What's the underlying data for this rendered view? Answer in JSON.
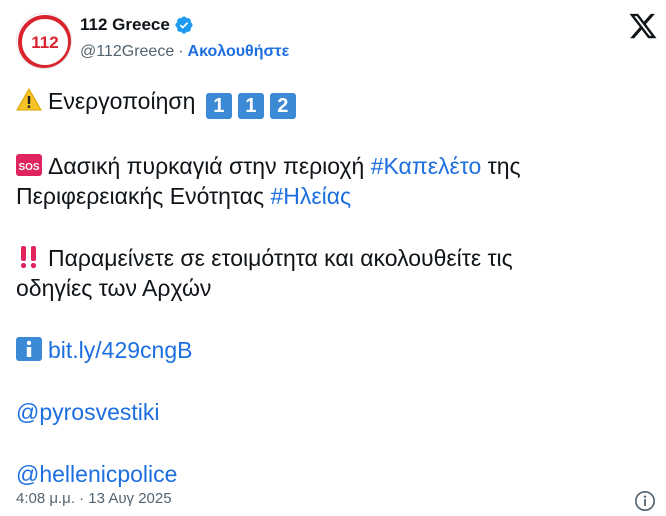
{
  "author": {
    "name": "112 Greece",
    "handle": "@112Greece",
    "separator": "·",
    "follow_label": "Ακολουθήστε",
    "avatar_text": "112"
  },
  "tweet": {
    "line1_text": "Ενεργοποίηση",
    "line1_digits": [
      "1",
      "1",
      "2"
    ],
    "line2_part1": "Δασική πυρκαγιά στην περιοχή",
    "hashtag1": "#Καπελέτο",
    "line2_part2": "της",
    "line3_part1": "Περιφερειακής Ενότητας",
    "hashtag2": "#Ηλείας",
    "line4": "Παραμείνετε σε ετοιμότητα και ακολουθείτε τις",
    "line5": "οδηγίες των Αρχών",
    "link": "bit.ly/429cngB",
    "mention1": "@pyrosvestiki",
    "mention2": "@hellenicpolice"
  },
  "footer": {
    "timestamp": "4:08 μ.μ. · 13 Αυγ 2025"
  },
  "colors": {
    "link": "#1d6fe0",
    "verified": "#1d9bf0",
    "sos": "#e0245e",
    "warning": "#f7c325",
    "number_box": "#3c8ad6"
  }
}
